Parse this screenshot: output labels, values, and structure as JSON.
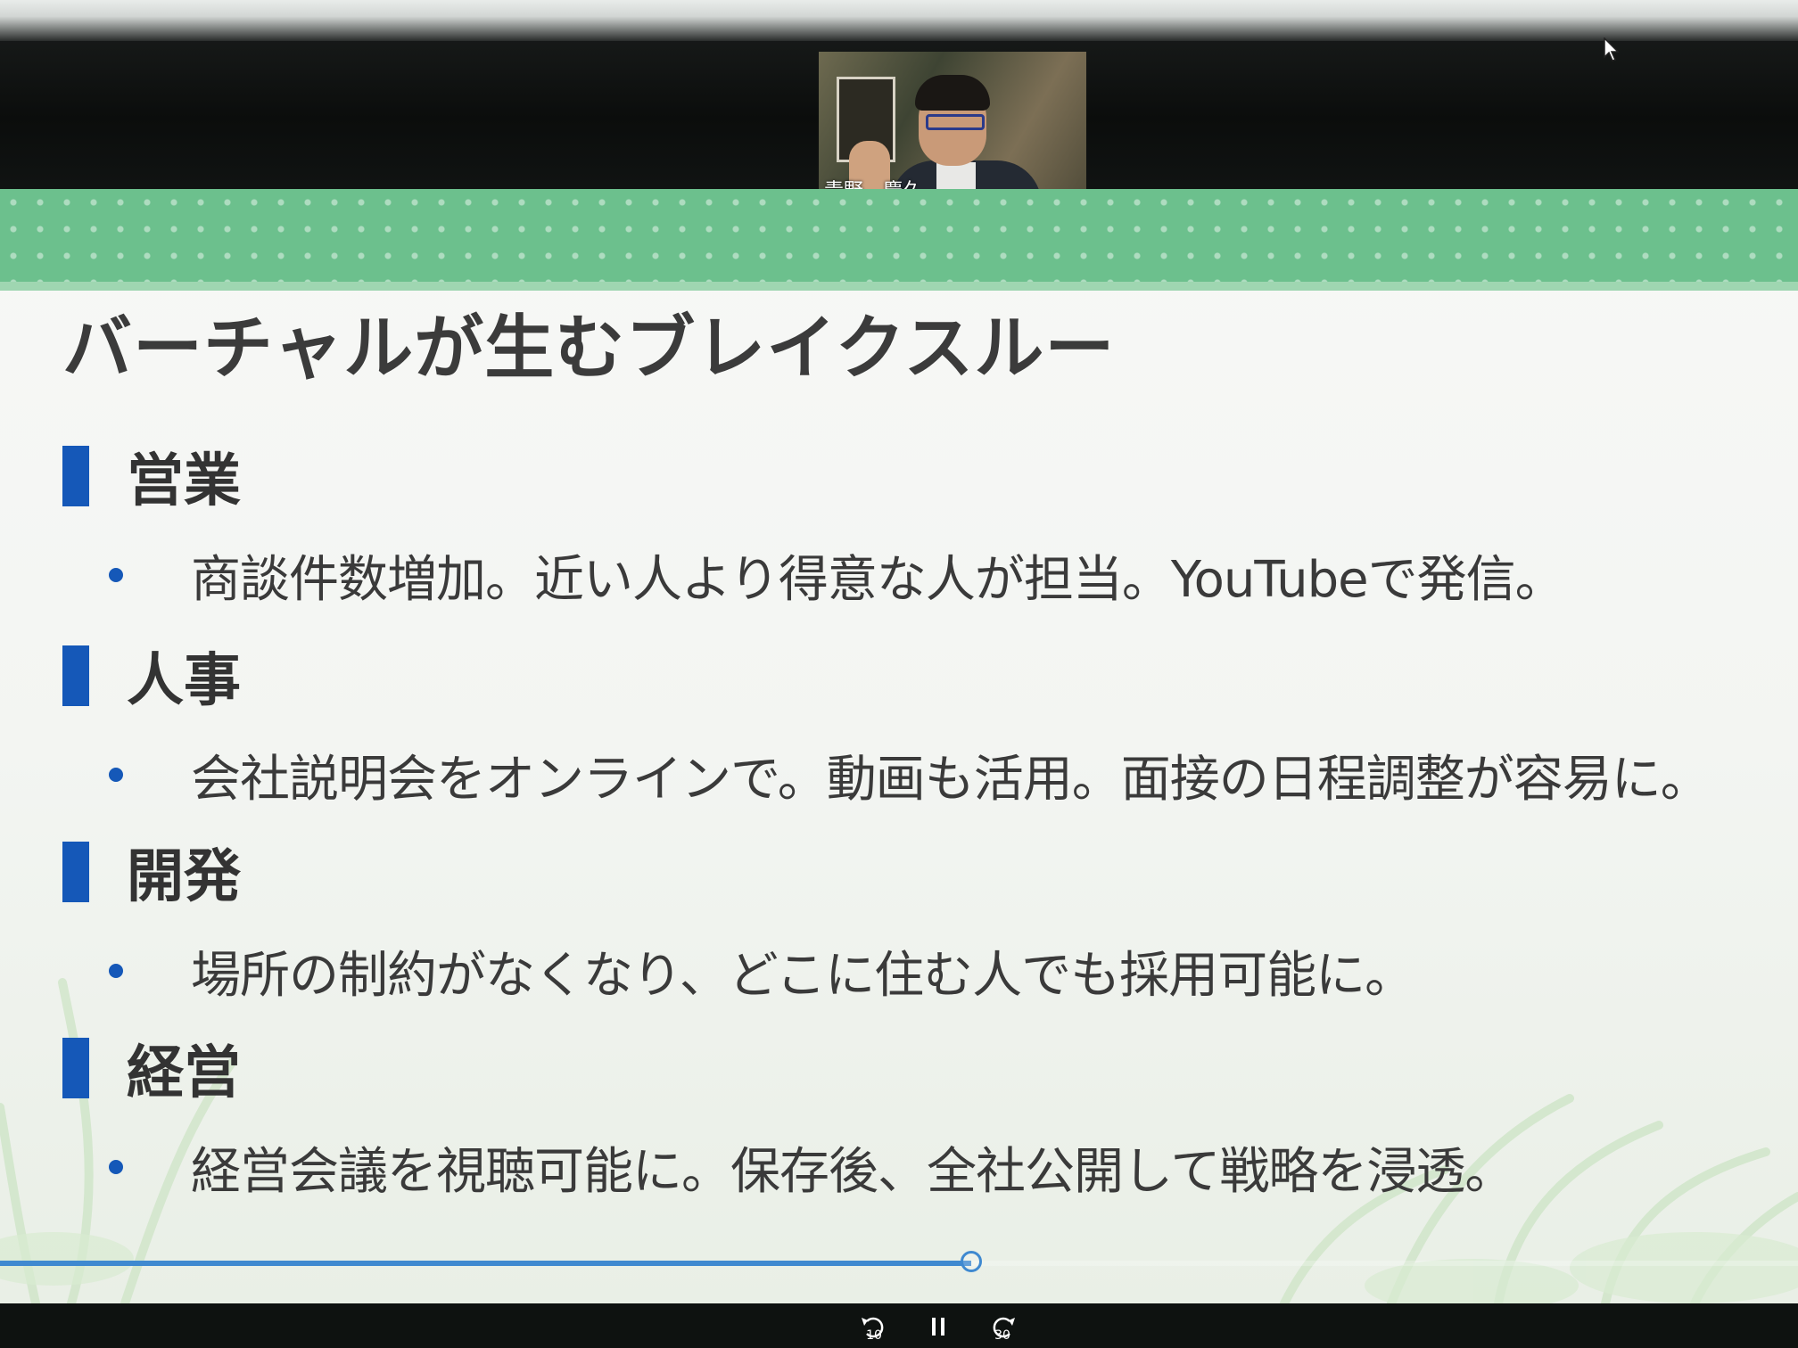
{
  "video": {
    "participant_name": "青野　慶久"
  },
  "slide": {
    "title": "バーチャルが生むブレイクスルー",
    "sections": [
      {
        "heading": "営業",
        "bullet": "商談件数増加。近い人より得意な人が担当。YouTubeで発信。"
      },
      {
        "heading": "人事",
        "bullet": "会社説明会をオンラインで。動画も活用。面接の日程調整が容易に。"
      },
      {
        "heading": "開発",
        "bullet": "場所の制約がなくなり、どこに住む人でも採用可能に。"
      },
      {
        "heading": "経営",
        "bullet": "経営会議を視聴可能に。保存後、全社公開して戦略を浸透。"
      }
    ]
  },
  "player": {
    "progress_percent": 54,
    "rewind_label": "10",
    "forward_label": "30"
  },
  "colors": {
    "banner": "#6cc08d",
    "marker": "#1558b8",
    "progress": "#3f89d0"
  },
  "icons": [
    "rewind-10-icon",
    "pause-icon",
    "forward-30-icon",
    "cursor-icon"
  ]
}
